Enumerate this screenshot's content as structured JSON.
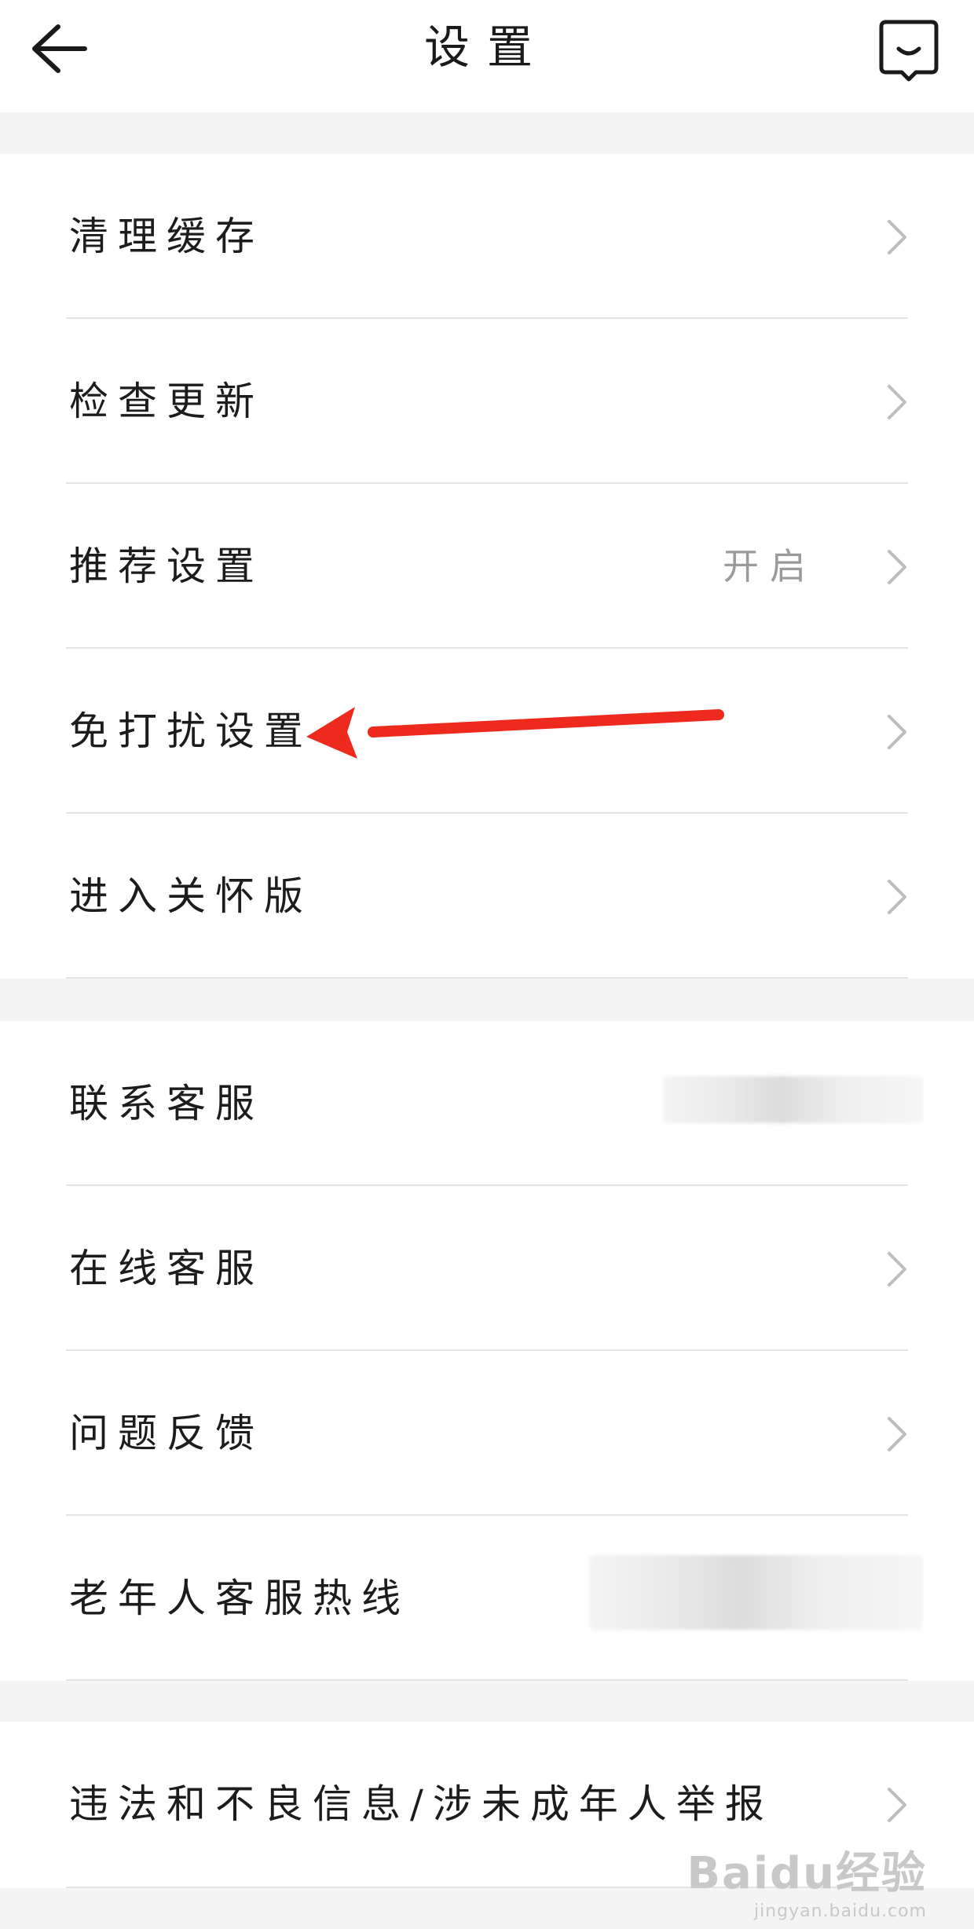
{
  "header": {
    "title": "设置",
    "back_icon": "arrow-left-icon",
    "message_icon": "message-smile-icon"
  },
  "groups": [
    {
      "items": [
        {
          "label": "清理缓存"
        },
        {
          "label": "检查更新"
        },
        {
          "label": "推荐设置",
          "value": "开启"
        },
        {
          "label": "免打扰设置"
        },
        {
          "label": "进入关怀版"
        }
      ]
    },
    {
      "items": [
        {
          "label": "联系客服"
        },
        {
          "label": "在线客服"
        },
        {
          "label": "问题反馈"
        },
        {
          "label": "老年人客服热线"
        }
      ]
    },
    {
      "items": [
        {
          "label": "违法和不良信息/涉未成年人举报"
        }
      ]
    }
  ],
  "annotation": {
    "color": "#ee2a1f"
  },
  "watermark": {
    "main": "Baidu经验",
    "sub": "jingyan.baidu.com"
  }
}
